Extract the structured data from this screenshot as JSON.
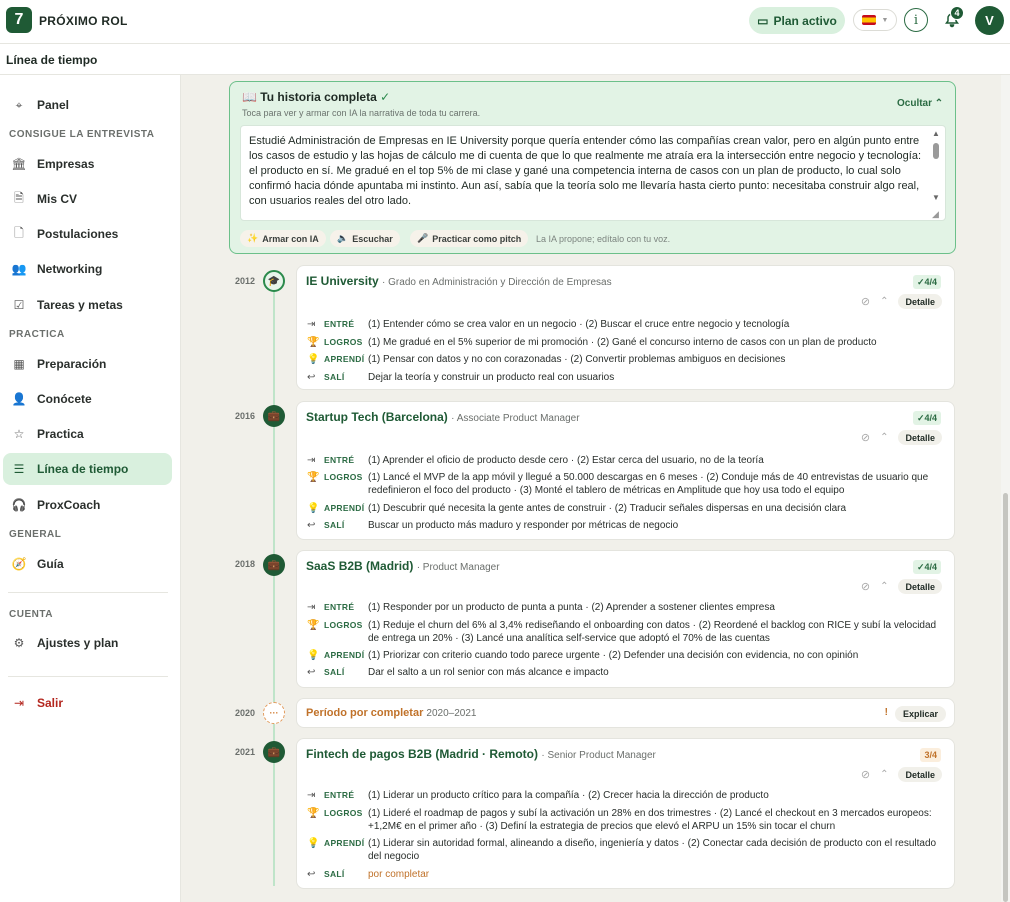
{
  "app": {
    "title": "PRÓXIMO ROL",
    "logo_letter": "7"
  },
  "header": {
    "plan_label": "Plan activo",
    "info_label": "i",
    "notifications_count": "4",
    "avatar_initial": "V"
  },
  "breadcrumb": {
    "title": "Línea de tiempo"
  },
  "sidebar": {
    "panel": "Panel",
    "section_interview": "CONSIGUE LA ENTREVISTA",
    "empresas": "Empresas",
    "mis_cv": "Mis CV",
    "postulaciones": "Postulaciones",
    "networking": "Networking",
    "tareas": "Tareas y metas",
    "section_practice": "PRACTICA",
    "preparacion": "Preparación",
    "conocete": "Conócete",
    "practica": "Practica",
    "linea": "Línea de tiempo",
    "proxcoach": "ProxCoach",
    "section_general": "GENERAL",
    "guia": "Guía",
    "section_account": "CUENTA",
    "ajustes": "Ajustes y plan",
    "salir": "Salir"
  },
  "story": {
    "title": "Tu historia completa",
    "check": "✓",
    "subtitle": "Toca para ver y armar con IA la narrativa de toda tu carrera.",
    "hide": "Ocultar",
    "text": "Estudié Administración de Empresas en IE University porque quería entender cómo las compañías crean valor, pero en algún punto entre los casos de estudio y las hojas de cálculo me di cuenta de que lo que realmente me atraía era la intersección entre negocio y tecnología: el producto en sí. Me gradué en el top 5% de mi clase y gané una competencia interna de casos con un plan de producto, lo cual solo confirmó hacia dónde apuntaba mi instinto. Aun así, sabía que la teoría solo me llevaría hasta cierto punto: necesitaba construir algo real, con usuarios reales del otro lado.",
    "btn_build": "Armar con IA",
    "btn_listen": "Escuchar",
    "btn_pitch": "Practicar como pitch",
    "note": "La IA propone; edítalo con tu voz."
  },
  "labels": {
    "entre": "ENTRÉ",
    "logros": "LOGROS",
    "aprendi": "APRENDÍ",
    "sali": "SALÍ",
    "detalle": "Detalle"
  },
  "timeline": [
    {
      "year": "2012",
      "name": "IE University",
      "role": "· Grado en Administración y Dirección de Empresas",
      "badge": "✓4/4",
      "entre": "(1) Entender cómo se crea valor en un negocio · (2) Buscar el cruce entre negocio y tecnología",
      "logros": "(1) Me gradué en el 5% superior de mi promoción · (2) Gané el concurso interno de casos con un plan de producto",
      "aprendi": "(1) Pensar con datos y no con corazonadas · (2) Convertir problemas ambiguos en decisiones",
      "sali": "Dejar la teoría y construir un producto real con usuarios"
    },
    {
      "year": "2016",
      "name": "Startup Tech (Barcelona)",
      "role": "· Associate Product Manager",
      "badge": "✓4/4",
      "entre": "(1) Aprender el oficio de producto desde cero · (2) Estar cerca del usuario, no de la teoría",
      "logros": "(1) Lancé el MVP de la app móvil y llegué a 50.000 descargas en 6 meses · (2) Conduje más de 40 entrevistas de usuario que redefinieron el foco del producto · (3) Monté el tablero de métricas en Amplitude que hoy usa todo el equipo",
      "aprendi": "(1) Descubrir qué necesita la gente antes de construir · (2) Traducir señales dispersas en una decisión clara",
      "sali": "Buscar un producto más maduro y responder por métricas de negocio"
    },
    {
      "year": "2018",
      "name": "SaaS B2B (Madrid)",
      "role": "· Product Manager",
      "badge": "✓4/4",
      "entre": "(1) Responder por un producto de punta a punta · (2) Aprender a sostener clientes empresa",
      "logros": "(1) Reduje el churn del 6% al 3,4% rediseñando el onboarding con datos · (2) Reordené el backlog con RICE y subí la velocidad de entrega un 20% · (3) Lancé una analítica self-service que adoptó el 70% de las cuentas",
      "aprendi": "(1) Priorizar con criterio cuando todo parece urgente · (2) Defender una decisión con evidencia, no con opinión",
      "sali": "Dar el salto a un rol senior con más alcance e impacto"
    },
    {
      "year": "2021",
      "name": "Fintech de pagos B2B (Madrid · Remoto)",
      "role": "· Senior Product Manager",
      "badge": "3/4",
      "entre": "(1) Liderar un producto crítico para la compañía · (2) Crecer hacia la dirección de producto",
      "logros": "(1) Lideré el roadmap de pagos y subí la activación un 28% en dos trimestres · (2) Lancé el checkout en 3 mercados europeos: +1,2M€ en el primer año · (3) Definí la estrategia de precios que elevó el ARPU un 15% sin tocar el churn",
      "aprendi": "(1) Liderar sin autoridad formal, alineando a diseño, ingeniería y datos · (2) Conectar cada decisión de producto con el resultado del negocio",
      "sali": "por completar"
    }
  ],
  "pending": {
    "year": "2020",
    "node": "···",
    "title": "Período por completar",
    "range": "2020–2021",
    "alert": "!",
    "explain": "Explicar"
  }
}
